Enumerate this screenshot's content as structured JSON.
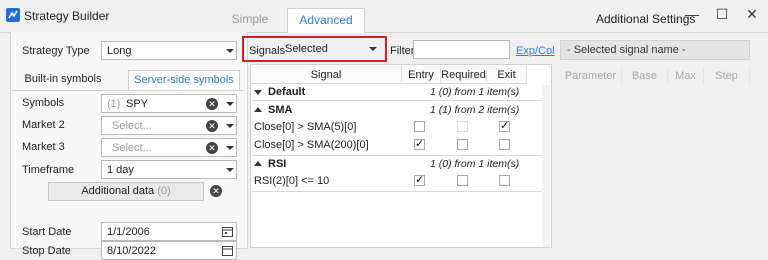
{
  "window": {
    "title": "Strategy Builder",
    "tabs": [
      "Simple",
      "Advanced"
    ],
    "active_tab": "Advanced",
    "additional_settings": "Additional Settings",
    "controls": {
      "minimize": "—",
      "maximize": "☐",
      "close": "✕"
    }
  },
  "left_panel": {
    "strategy_type_label": "Strategy Type",
    "strategy_type_value": "Long",
    "tabs": [
      "Built-in symbols",
      "Server-side symbols"
    ],
    "symbols_label": "Symbols",
    "symbols_count": "(1)",
    "symbols_value": "SPY",
    "market2_label": "Market 2",
    "market2_placeholder": "Select...",
    "market3_label": "Market 3",
    "market3_placeholder": "Select...",
    "timeframe_label": "Timeframe",
    "timeframe_value": "1 day",
    "additional_data_label": "Additional data",
    "additional_data_count": "(0)",
    "start_date_label": "Start Date",
    "start_date_value": "1/1/2006",
    "stop_date_label": "Stop Date",
    "stop_date_value": "8/10/2022"
  },
  "signals_toolbar": {
    "signals_label": "Signals",
    "signals_value": "Selected",
    "filter_label": "Filter",
    "filter_value": "",
    "exp_col_link": "Exp/Col"
  },
  "signals_grid": {
    "columns": [
      "Signal",
      "Entry",
      "Required",
      "Exit"
    ],
    "groups": [
      {
        "name": "Default",
        "info": "1 (0) from 1 item(s)",
        "expanded": false,
        "rows": []
      },
      {
        "name": "SMA",
        "info": "1 (1) from 2 item(s)",
        "expanded": true,
        "rows": [
          {
            "signal": "Close[0] > SMA(5)[0]",
            "entry": false,
            "required": false,
            "exit": true
          },
          {
            "signal": "Close[0] > SMA(200)[0]",
            "entry": true,
            "required": false,
            "exit": false
          }
        ]
      },
      {
        "name": "RSI",
        "info": "1 (0) from 1 item(s)",
        "expanded": true,
        "rows": [
          {
            "signal": "RSI(2)[0] <= 10",
            "entry": true,
            "required": false,
            "exit": false
          }
        ]
      }
    ]
  },
  "right_panel": {
    "selected_signal_name": "- Selected signal name -",
    "columns": [
      "Parameter",
      "Base",
      "Max",
      "Step"
    ]
  },
  "colors": {
    "accent": "#2f7fd1",
    "highlight_border": "#e01b1b"
  },
  "icons": {
    "app": "strategy-builder-icon",
    "clear": "clear-x-icon",
    "dropdown": "chevron-down-icon",
    "calendar": "calendar-icon",
    "collapse": "triangle-icon"
  }
}
